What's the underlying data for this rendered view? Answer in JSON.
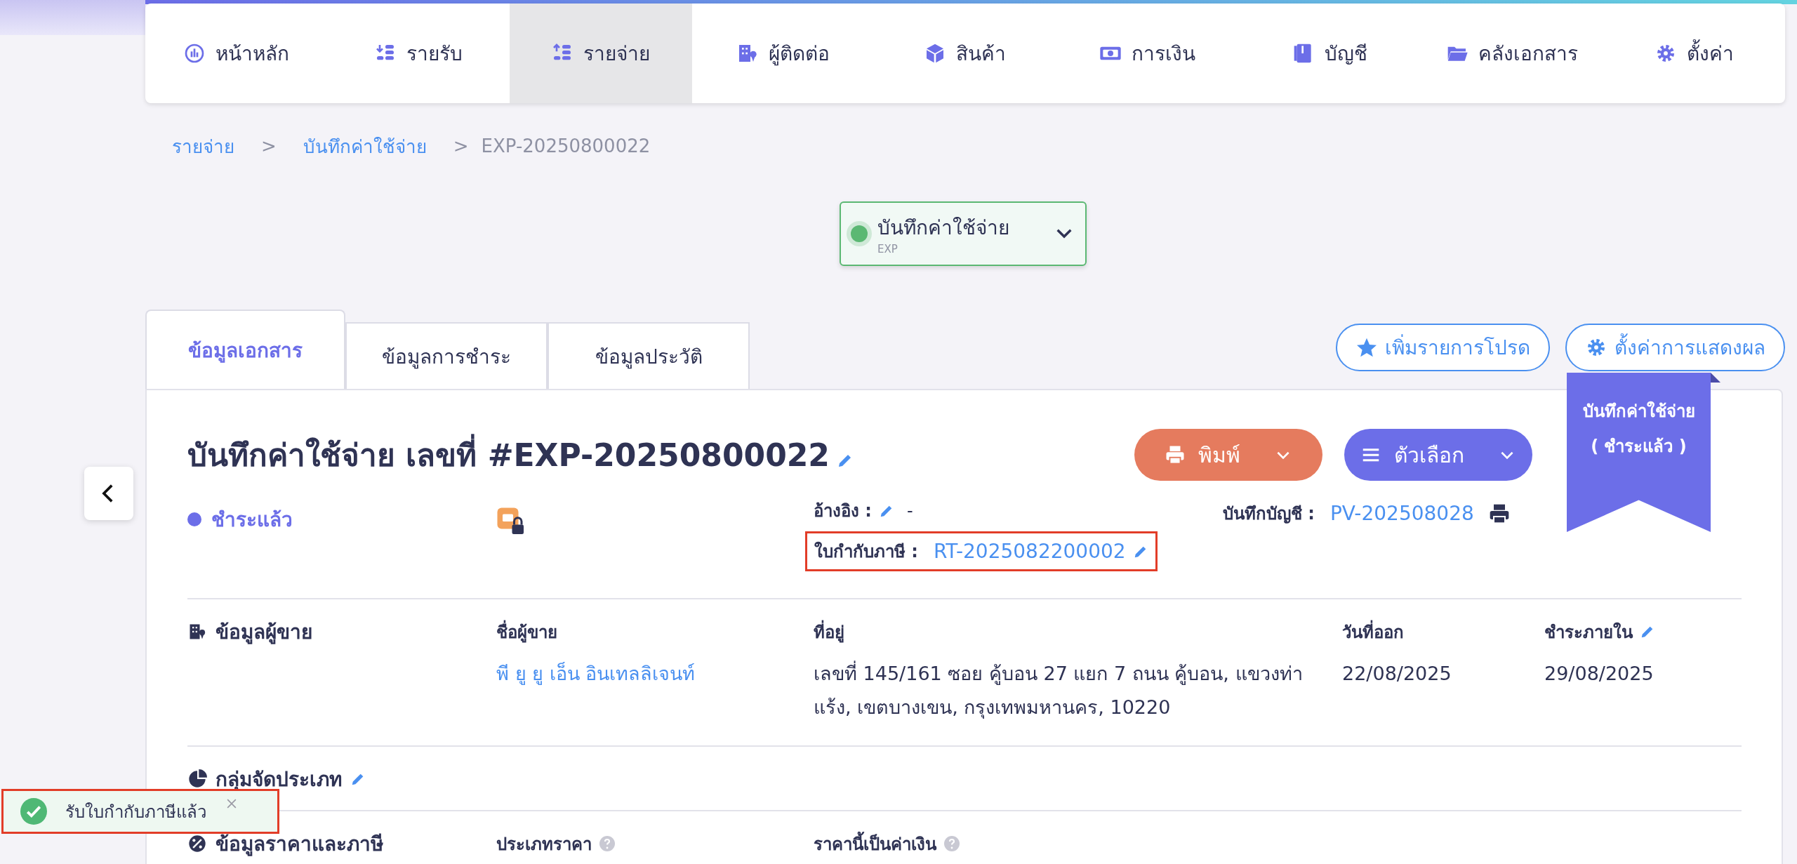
{
  "nav": [
    {
      "label": "หน้าหลัก",
      "selected": false
    },
    {
      "label": "รายรับ",
      "selected": false
    },
    {
      "label": "รายจ่าย",
      "selected": true
    },
    {
      "label": "ผู้ติดต่อ",
      "selected": false
    },
    {
      "label": "สินค้า",
      "selected": false
    },
    {
      "label": "การเงิน",
      "selected": false
    },
    {
      "label": "บัญชี",
      "selected": false
    },
    {
      "label": "คลังเอกสาร",
      "selected": false
    },
    {
      "label": "ตั้งค่า",
      "selected": false
    }
  ],
  "breadcrumb": {
    "items": [
      "รายจ่าย",
      "บันทึกค่าใช้จ่าย",
      "EXP-20250800022"
    ],
    "separator": ">"
  },
  "doc_type": {
    "label": "บันทึกค่าใช้จ่าย",
    "code": "EXP"
  },
  "tabs": [
    {
      "label": "ข้อมูลเอกสาร",
      "selected": true
    },
    {
      "label": "ข้อมูลการชำระ",
      "selected": false
    },
    {
      "label": "ข้อมูลประวัติ",
      "selected": false
    }
  ],
  "actions": [
    "เพิ่มรายการโปรด",
    "ตั้งค่าการแสดงผล"
  ],
  "ribbon": [
    "บันทึกค่าใช้จ่าย",
    "( ชำระแล้ว )"
  ],
  "title": "บันทึกค่าใช้จ่าย เลขที่ #EXP-20250800022",
  "buttons": {
    "print": "พิมพ์",
    "options": "ตัวเลือก"
  },
  "status": "ชำระแล้ว",
  "reference": {
    "label": "อ้างอิง :",
    "value": "-"
  },
  "tax_invoice": {
    "label": "ใบกำกับภาษี :",
    "value": "RT-2025082200002",
    "highlighted": true
  },
  "account": {
    "label": "บันทึกบัญชี :",
    "value": "PV-202508028"
  },
  "vendor": {
    "title": "ข้อมูลผู้ขาย",
    "fields": [
      {
        "label": "ชื่อผู้ขาย",
        "value": "พี ยู ยู เอ็น อินเทลลิเจนท์",
        "kind": "link"
      },
      {
        "label": "ที่อยู่",
        "value": "เลขที่ 145/161 ซอย คู้บอน 27 แยก 7 ถนน คู้บอน, แขวงท่าแร้ง, เขตบางเขน, กรุงเทพมหานคร, 10220",
        "kind": "text"
      },
      {
        "label": "วันที่ออก",
        "value": "22/08/2025",
        "kind": "text"
      },
      {
        "label": "ชำระภายใน",
        "value": "29/08/2025",
        "kind": "editable"
      }
    ]
  },
  "category": {
    "title": "กลุ่มจัดประเภท"
  },
  "pricing": {
    "title": "ข้อมูลราคาและภาษี",
    "fields": [
      "ประเภทราคา",
      "ราคานี้เป็นค่าเงิน"
    ]
  },
  "toast": {
    "message": "รับใบกำกับภาษีแล้ว",
    "highlighted": true
  }
}
